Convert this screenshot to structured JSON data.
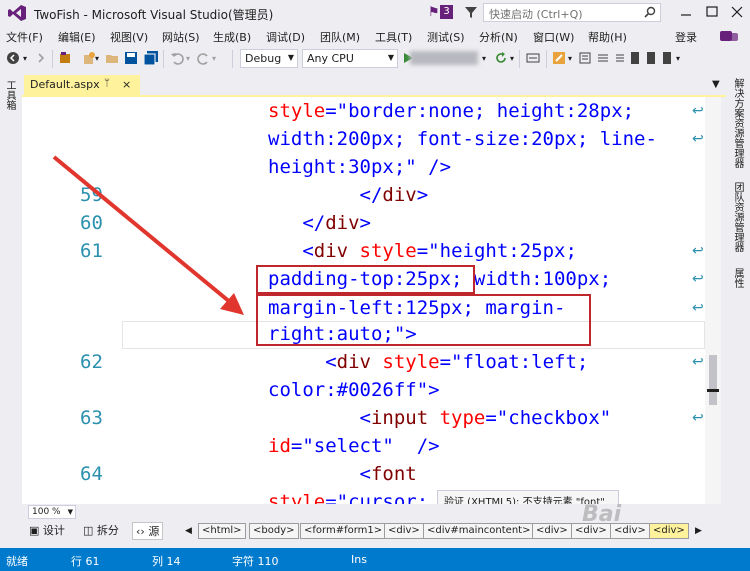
{
  "window": {
    "title": "TwoFish - Microsoft Visual Studio(管理员)",
    "notification_count": "3",
    "quick_launch_placeholder": "快速启动 (Ctrl+Q)"
  },
  "menu": {
    "items": [
      "文件(F)",
      "编辑(E)",
      "视图(V)",
      "网站(S)",
      "生成(B)",
      "调试(D)",
      "团队(M)",
      "工具(T)",
      "测试(S)",
      "分析(N)",
      "窗口(W)",
      "帮助(H)"
    ],
    "login": "登录"
  },
  "toolbar": {
    "config": "Debug",
    "platform": "Any CPU"
  },
  "side_panels": {
    "left": "工具箱",
    "right": [
      "解决方案资源管理器",
      "团队资源管理器",
      "属性"
    ]
  },
  "tab": {
    "label": "Default.aspx",
    "pin": "ᛘ",
    "close": "×"
  },
  "editor": {
    "lines": [
      {
        "num": "",
        "parts": [
          [
            "attr",
            "style"
          ],
          [
            "br",
            "=\""
          ],
          [
            "val",
            "border:none; height:28px;"
          ]
        ]
      },
      {
        "num": "",
        "parts": [
          [
            "val",
            "width:200px; font-size:20px; line-"
          ]
        ]
      },
      {
        "num": "",
        "parts": [
          [
            "val",
            "height:30px;"
          ],
          [
            "br",
            "\" />"
          ]
        ]
      },
      {
        "num": "59",
        "parts": [
          [
            "br",
            "        </"
          ],
          [
            "tag",
            "div"
          ],
          [
            "br",
            ">"
          ]
        ]
      },
      {
        "num": "60",
        "parts": [
          [
            "br",
            "   </"
          ],
          [
            "tag",
            "div"
          ],
          [
            "br",
            ">"
          ]
        ]
      },
      {
        "num": "61",
        "parts": [
          [
            "br",
            "   <"
          ],
          [
            "tag",
            "div"
          ],
          [
            "attr",
            " style"
          ],
          [
            "br",
            "=\""
          ],
          [
            "val",
            "height:25px;"
          ]
        ]
      },
      {
        "num": "",
        "parts": [
          [
            "val",
            "padding-top:25px; width:100px;"
          ]
        ]
      },
      {
        "num": "",
        "parts": [
          [
            "val",
            "margin-left:125px; margin-"
          ]
        ]
      },
      {
        "num": "",
        "parts": [
          [
            "val",
            "right:auto;"
          ],
          [
            "br",
            "\">"
          ]
        ]
      },
      {
        "num": "62",
        "parts": [
          [
            "br",
            "     <"
          ],
          [
            "tag",
            "div"
          ],
          [
            "attr",
            " style"
          ],
          [
            "br",
            "=\""
          ],
          [
            "val",
            "float:left;"
          ]
        ]
      },
      {
        "num": "",
        "parts": [
          [
            "val",
            "color:#0026ff"
          ],
          [
            "br",
            "\">"
          ]
        ]
      },
      {
        "num": "63",
        "parts": [
          [
            "br",
            "        <"
          ],
          [
            "tag",
            "input"
          ],
          [
            "attr",
            " type"
          ],
          [
            "br",
            "=\""
          ],
          [
            "val",
            "checkbox"
          ],
          [
            "br",
            "\""
          ]
        ]
      },
      {
        "num": "",
        "parts": [
          [
            "attr",
            "id"
          ],
          [
            "br",
            "=\""
          ],
          [
            "val",
            "select"
          ],
          [
            "br",
            "\"  />"
          ]
        ]
      },
      {
        "num": "64",
        "parts": [
          [
            "br",
            "        <"
          ],
          [
            "tag",
            "font"
          ]
        ]
      },
      {
        "num": "",
        "parts": [
          [
            "attr",
            "style"
          ],
          [
            "br",
            "=\""
          ],
          [
            "val",
            "cursor:"
          ]
        ]
      }
    ],
    "tooltip": "验证 (XHTML5): 不支持元素 \"font\""
  },
  "bottom": {
    "zoom": "100 %",
    "views": [
      "设计",
      "拆分",
      "源"
    ],
    "breadcrumbs": [
      "<html>",
      "<body>",
      "<form#form1>",
      "<div>",
      "<div#maincontent>",
      "<div>",
      "<div>",
      "<div>",
      "<div>"
    ],
    "watermark": "Bai"
  },
  "status": {
    "ready": "就绪",
    "line": "行 61",
    "col": "列 14",
    "char": "字符 110",
    "mode": "Ins"
  },
  "colors": {
    "accent": "#007ACC",
    "tab_highlight": "#FFF29D",
    "annotation": "#C0272D"
  }
}
